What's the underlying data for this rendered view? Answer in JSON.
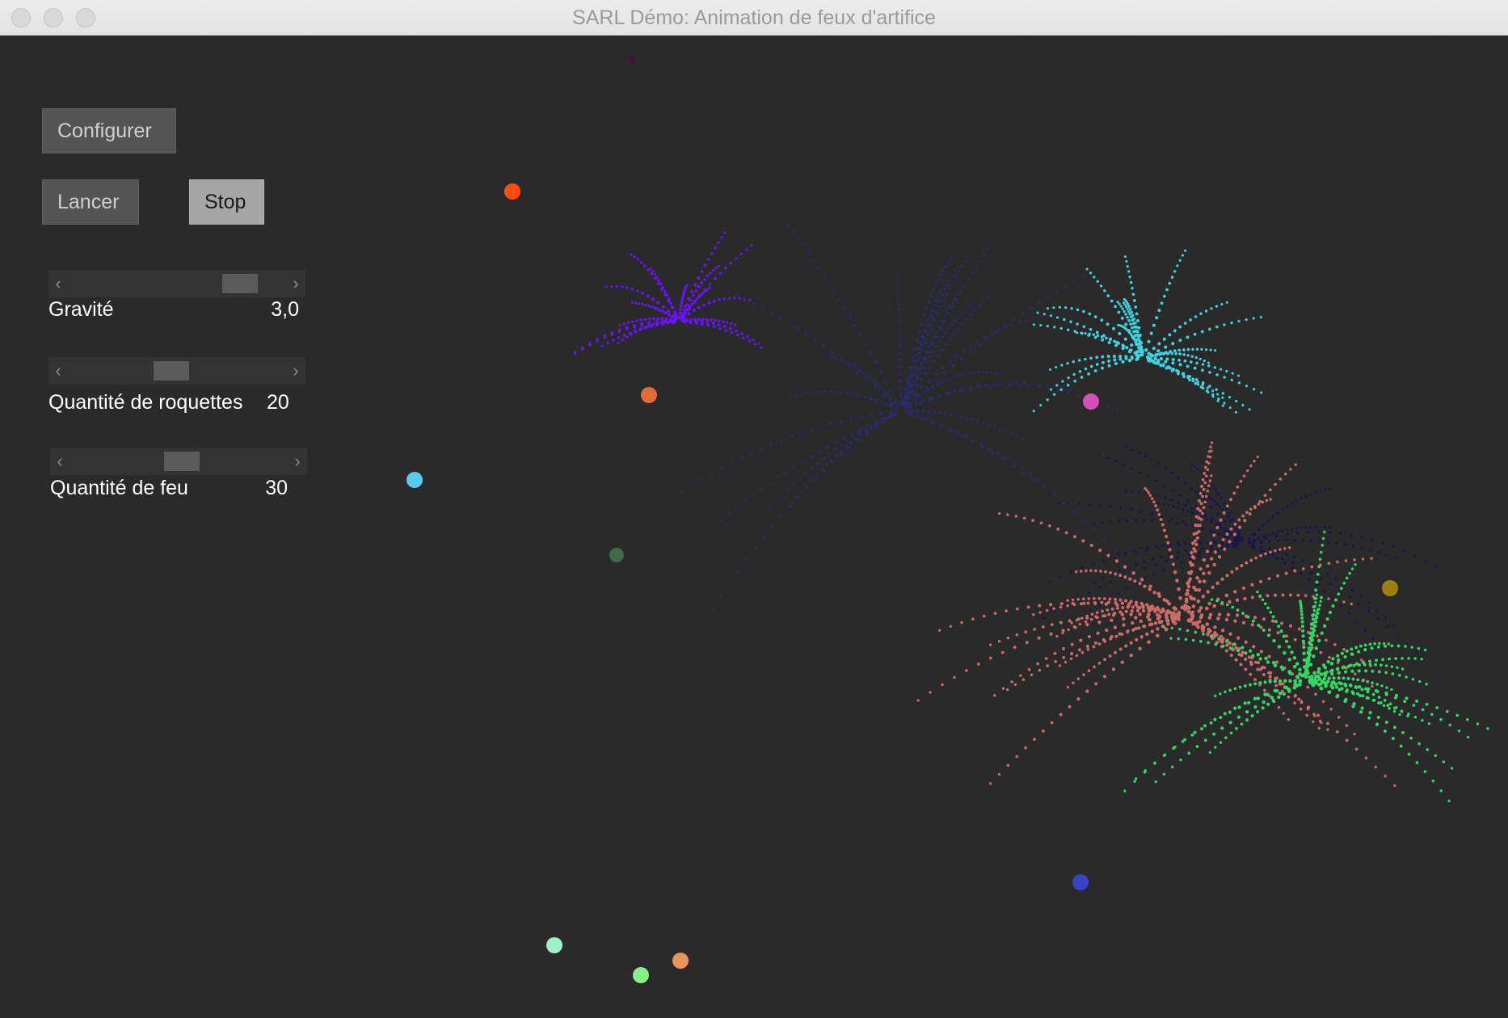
{
  "window": {
    "title": "SARL Démo: Animation de feux d'artifice",
    "background_color": "#2a2a2a"
  },
  "controls": {
    "configure_label": "Configurer",
    "launch_label": "Lancer",
    "stop_label": "Stop",
    "gravity": {
      "label": "Gravité",
      "value": "3,0",
      "level": 0.85
    },
    "rockets": {
      "label": "Quantité de roquettes",
      "value": "20",
      "level": 0.47
    },
    "fire": {
      "label": "Quantité de feu",
      "value": "30",
      "level": 0.52
    }
  },
  "scene": {
    "bursts": [
      {
        "name": "violet",
        "color": "#6a12f5",
        "spread": 1.0
      },
      {
        "name": "navy",
        "color": "#2a2a72",
        "spread": 1.0
      },
      {
        "name": "cyan",
        "color": "#3fd1dd",
        "spread": 1.0
      },
      {
        "name": "dark-indigo",
        "color": "#1a1550",
        "spread": 1.0
      },
      {
        "name": "salmon",
        "color": "#cc6a6a",
        "spread": 1.0
      },
      {
        "name": "green",
        "color": "#36d464",
        "spread": 1.0
      }
    ],
    "rocket_colors": [
      "#ff4d12",
      "#e56a3a",
      "#5bc8f0",
      "#3e6b49",
      "#d24fb5",
      "#a07f10",
      "#3a44c8",
      "#9ef0c8",
      "#88ee88",
      "#e8945a",
      "#4a0f3a"
    ]
  }
}
